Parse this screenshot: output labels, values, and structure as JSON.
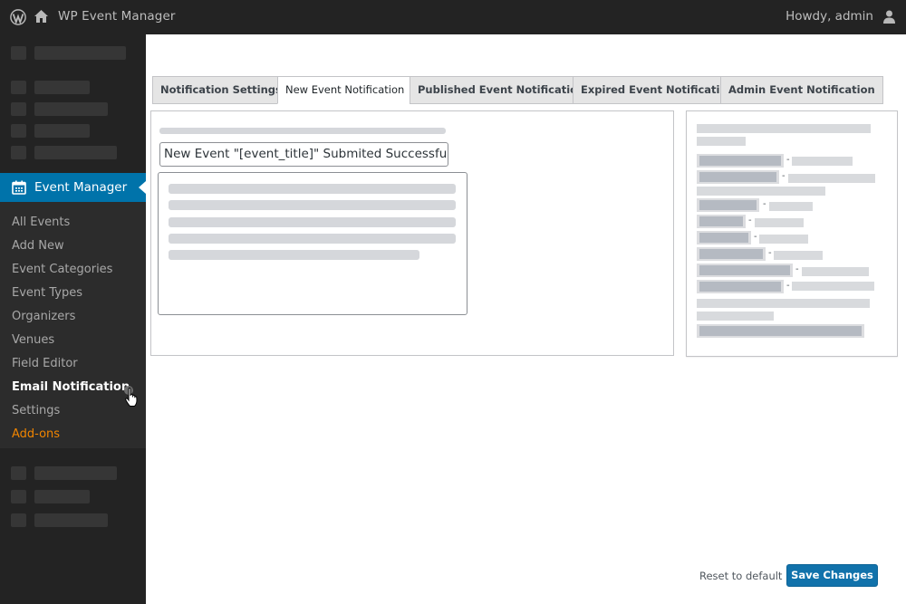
{
  "adminbar": {
    "site_name": "WP Event Manager",
    "greeting": "Howdy, admin",
    "icons": {
      "logo": "wordpress-logo-icon",
      "home": "home-icon",
      "user": "user-icon"
    }
  },
  "sidebar": {
    "active_menu": {
      "label": "Event Manager",
      "icon": "calendar-icon"
    },
    "submenu": [
      {
        "label": "All Events"
      },
      {
        "label": "Add New"
      },
      {
        "label": "Event Categories"
      },
      {
        "label": "Event Types"
      },
      {
        "label": "Organizers"
      },
      {
        "label": "Venues"
      },
      {
        "label": "Field Editor"
      },
      {
        "label": "Email Notification",
        "current": true
      },
      {
        "label": "Settings"
      },
      {
        "label": "Add-ons"
      }
    ]
  },
  "tabs": [
    {
      "label": "Notification Settings"
    },
    {
      "label": "New Event Notification",
      "active": true
    },
    {
      "label": "Published Event Notification"
    },
    {
      "label": "Expired Event Notification"
    },
    {
      "label": "Admin Event Notification"
    }
  ],
  "main_panel": {
    "subject_value": "New Event \"[event_title]\" Submited Successfully"
  },
  "footer": {
    "reset_label": "Reset to default",
    "save_label": "Save Changes"
  },
  "colors": {
    "accent": "#0073aa",
    "addons": "#f18500",
    "adminbar_bg": "#232323",
    "save_button": "#1172ab"
  }
}
